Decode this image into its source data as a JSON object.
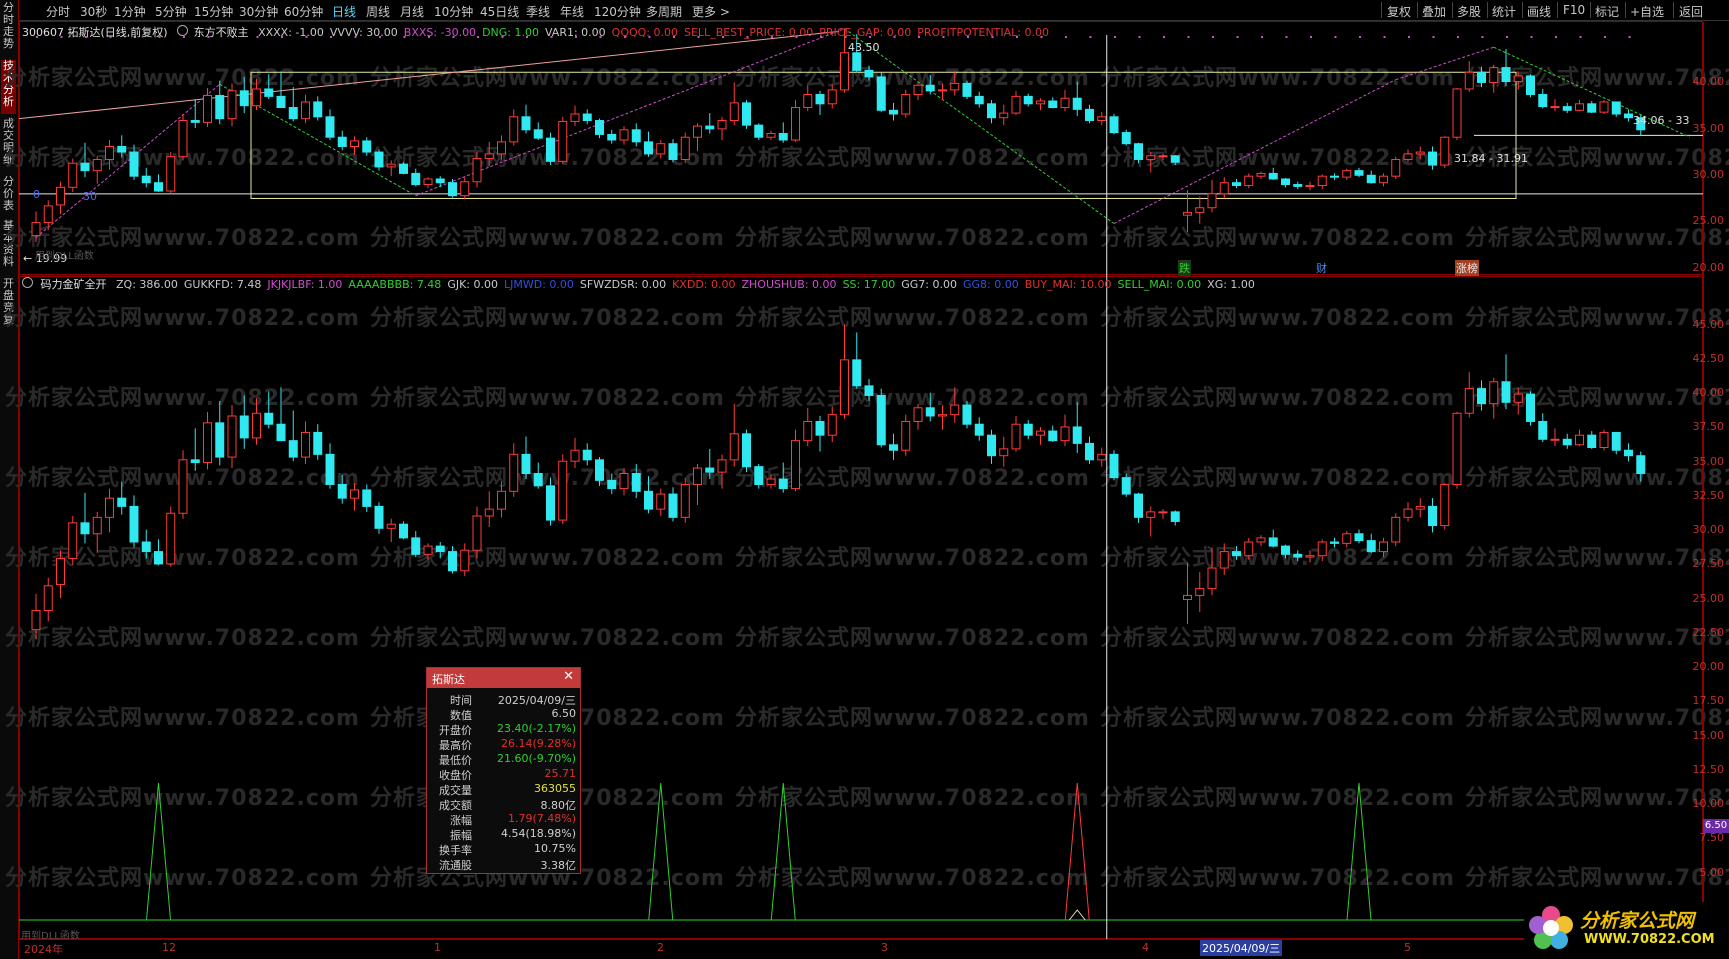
{
  "left_tabs": [
    "分时走势",
    "技术分析",
    "成交明细",
    "分价表",
    "基本资料",
    "开盘竞复"
  ],
  "toolbar": {
    "periods": [
      "分时",
      "30秒",
      "1分钟",
      "5分钟",
      "15分钟",
      "30分钟",
      "60分钟",
      "日线",
      "周线",
      "月线",
      "10分钟",
      "45日线",
      "季线",
      "年线",
      "120分钟",
      "多周期",
      "更多 >"
    ],
    "active_period": "日线",
    "right_items": [
      "复权",
      "叠加",
      "多股",
      "统计",
      "画线",
      "F10",
      "标记",
      "+自选",
      "返回"
    ]
  },
  "main_info": {
    "stock": "300607 拓斯达(日线,前复权)",
    "indicator_name": "东方不败主",
    "values": [
      {
        "text": "XXXX: -1.00",
        "color": "#c8c8c8"
      },
      {
        "text": "VVVV: 30.00",
        "color": "#c8c8c8"
      },
      {
        "text": "BXXS: -30.00",
        "color": "#d24cd2"
      },
      {
        "text": "DNG: 1.00",
        "color": "#30d030"
      },
      {
        "text": "VAR1: 0.00",
        "color": "#c8c8c8"
      },
      {
        "text": "QQQQ: 0.00",
        "color": "#e03030"
      },
      {
        "text": "SELL_BEST_PRICE: 0.00",
        "color": "#e03030"
      },
      {
        "text": "PRICE_GAP: 0.00",
        "color": "#e03030"
      },
      {
        "text": "PROFITPOTENTIAL: 0.00",
        "color": "#e03030"
      }
    ]
  },
  "main_annotations": {
    "high_label": "43.50",
    "low_label": "19.99",
    "range_label": "31.84 - 31.91",
    "right_label": "34.06 - 33",
    "markers": [
      "跌",
      "财",
      "涨榜"
    ],
    "small_zero": "0",
    "small_30": "30"
  },
  "main_axis": [
    "40.00",
    "35.00",
    "30.00",
    "25.00",
    "20.00"
  ],
  "sub_info": {
    "name": "码力金矿全开",
    "values": [
      {
        "text": "ZQ: 386.00",
        "color": "#c8c8c8"
      },
      {
        "text": "GUKKFD: 7.48",
        "color": "#c8c8c8"
      },
      {
        "text": "JKJKJLBF: 1.00",
        "color": "#d24cd2"
      },
      {
        "text": "AAAABBBB: 7.48",
        "color": "#30d030"
      },
      {
        "text": "GJK: 0.00",
        "color": "#c8c8c8"
      },
      {
        "text": "LJMWD: 0.00",
        "color": "#3050e0"
      },
      {
        "text": "SFWZDSR: 0.00",
        "color": "#c8c8c8"
      },
      {
        "text": "KXDD: 0.00",
        "color": "#e03030"
      },
      {
        "text": "ZHOUSHUB: 0.00",
        "color": "#d24cd2"
      },
      {
        "text": "SS: 17.00",
        "color": "#30d030"
      },
      {
        "text": "GG7: 0.00",
        "color": "#c8c8c8"
      },
      {
        "text": "GG8: 0.00",
        "color": "#3050e0"
      },
      {
        "text": "BUY_MAI: 10.00",
        "color": "#e03030"
      },
      {
        "text": "SELL_MAI: 0.00",
        "color": "#30d030"
      },
      {
        "text": "XG: 1.00",
        "color": "#c8c8c8"
      }
    ]
  },
  "sub_axis": [
    "45.00",
    "42.50",
    "40.00",
    "37.50",
    "35.00",
    "32.50",
    "30.00",
    "27.50",
    "25.00",
    "22.50",
    "20.00",
    "17.50",
    "15.00",
    "12.50",
    "10.00",
    "7.50",
    "5.00"
  ],
  "current_value_tag": "6.50",
  "bottom_note": "用到DLL函数",
  "top_note": "用到DLL函数",
  "date_axis": {
    "labels": [
      "2024年",
      "12",
      "1",
      "2",
      "3",
      "4",
      "5"
    ],
    "cursor_date": "2025/04/09/三"
  },
  "popup": {
    "title": "拓斯达",
    "rows": [
      {
        "label": "时间",
        "value": "2025/04/09/三",
        "color": "#d0d0d0"
      },
      {
        "label": "数值",
        "value": "6.50",
        "color": "#d0d0d0"
      },
      {
        "label": "开盘价",
        "value": "23.40(-2.17%)",
        "color": "#30d030"
      },
      {
        "label": "最高价",
        "value": "26.14(9.28%)",
        "color": "#e03030"
      },
      {
        "label": "最低价",
        "value": "21.60(-9.70%)",
        "color": "#30d030"
      },
      {
        "label": "收盘价",
        "value": "25.71",
        "color": "#e03030"
      },
      {
        "label": "成交量",
        "value": "363055",
        "color": "#e0e040"
      },
      {
        "label": "成交额",
        "value": "8.80亿",
        "color": "#d0d0d0"
      },
      {
        "label": "涨幅",
        "value": "1.79(7.48%)",
        "color": "#e03030"
      },
      {
        "label": "振幅",
        "value": "4.54(18.98%)",
        "color": "#d0d0d0"
      },
      {
        "label": "换手率",
        "value": "10.75%",
        "color": "#d0d0d0"
      },
      {
        "label": "流通股",
        "value": "3.38亿",
        "color": "#d0d0d0"
      }
    ]
  },
  "watermark": "分析家公式网www.70822.com",
  "logo": {
    "text": "分析家公式网",
    "url": "WWW.70822.COM"
  },
  "chart_data": {
    "type": "candlestick",
    "series_name": "拓斯达",
    "ohlc": [
      [
        21.2,
        23.8,
        20.5,
        22.6
      ],
      [
        22.6,
        25.0,
        21.8,
        24.4
      ],
      [
        24.5,
        27.0,
        23.5,
        26.4
      ],
      [
        26.4,
        29.5,
        25.9,
        29.0
      ],
      [
        29.0,
        31.2,
        27.5,
        28.2
      ],
      [
        28.2,
        29.8,
        26.8,
        29.4
      ],
      [
        29.4,
        31.5,
        28.3,
        30.8
      ],
      [
        30.8,
        32.0,
        29.6,
        30.2
      ],
      [
        30.2,
        31.0,
        27.2,
        27.6
      ],
      [
        27.6,
        28.5,
        26.4,
        26.9
      ],
      [
        26.9,
        27.8,
        25.9,
        26.0
      ],
      [
        26.0,
        30.2,
        25.8,
        29.7
      ],
      [
        29.7,
        34.3,
        29.3,
        33.6
      ],
      [
        33.6,
        35.9,
        32.8,
        33.4
      ],
      [
        33.4,
        37.1,
        32.9,
        36.3
      ],
      [
        36.3,
        37.9,
        33.2,
        33.8
      ],
      [
        33.8,
        37.6,
        33.0,
        36.8
      ],
      [
        36.8,
        38.3,
        34.4,
        35.2
      ],
      [
        35.2,
        38.1,
        34.7,
        37.0
      ],
      [
        37.0,
        38.6,
        35.9,
        36.2
      ],
      [
        36.2,
        38.9,
        35.6,
        35.0
      ],
      [
        35.0,
        37.2,
        33.5,
        33.8
      ],
      [
        33.8,
        36.4,
        33.3,
        35.6
      ],
      [
        35.6,
        36.2,
        33.6,
        34.0
      ],
      [
        34.0,
        34.8,
        31.5,
        31.8
      ],
      [
        31.8,
        32.5,
        30.4,
        30.8
      ],
      [
        30.8,
        31.9,
        29.9,
        31.4
      ],
      [
        31.4,
        31.8,
        29.8,
        30.2
      ],
      [
        30.2,
        30.5,
        28.2,
        28.6
      ],
      [
        28.6,
        29.3,
        27.6,
        28.9
      ],
      [
        28.9,
        29.1,
        27.8,
        27.9
      ],
      [
        27.9,
        28.4,
        26.5,
        26.7
      ],
      [
        26.7,
        27.5,
        26.3,
        27.3
      ],
      [
        27.3,
        27.6,
        26.4,
        26.9
      ],
      [
        26.9,
        27.3,
        25.3,
        25.5
      ],
      [
        25.5,
        27.5,
        25.1,
        27.0
      ],
      [
        27.0,
        30.2,
        26.4,
        29.5
      ],
      [
        29.5,
        31.3,
        28.7,
        30.0
      ],
      [
        30.0,
        32.0,
        29.4,
        31.3
      ],
      [
        31.3,
        34.8,
        30.9,
        34.0
      ],
      [
        34.0,
        35.3,
        32.2,
        32.6
      ],
      [
        32.6,
        33.4,
        31.5,
        31.7
      ],
      [
        31.7,
        32.3,
        28.8,
        29.2
      ],
      [
        29.2,
        34.0,
        28.9,
        33.5
      ],
      [
        33.5,
        35.2,
        33.0,
        34.3
      ],
      [
        34.3,
        34.8,
        33.2,
        33.6
      ],
      [
        33.6,
        33.8,
        31.7,
        32.1
      ],
      [
        32.1,
        32.6,
        31.1,
        31.5
      ],
      [
        31.5,
        33.0,
        31.0,
        32.6
      ],
      [
        32.6,
        33.3,
        30.8,
        31.3
      ],
      [
        31.3,
        32.4,
        29.7,
        30.0
      ],
      [
        30.0,
        31.5,
        29.5,
        31.1
      ],
      [
        31.1,
        31.6,
        29.1,
        29.4
      ],
      [
        29.4,
        32.3,
        29.0,
        31.8
      ],
      [
        31.8,
        33.3,
        30.3,
        33.0
      ],
      [
        33.0,
        34.4,
        32.2,
        32.7
      ],
      [
        32.7,
        34.0,
        31.5,
        33.6
      ],
      [
        33.6,
        37.7,
        33.1,
        35.5
      ],
      [
        35.5,
        35.8,
        32.7,
        33.1
      ],
      [
        33.1,
        33.3,
        31.5,
        31.8
      ],
      [
        31.8,
        32.5,
        31.5,
        32.2
      ],
      [
        32.2,
        33.4,
        31.2,
        31.5
      ],
      [
        31.5,
        35.8,
        31.3,
        35.0
      ],
      [
        35.0,
        37.4,
        34.6,
        36.4
      ],
      [
        36.4,
        36.8,
        34.2,
        35.4
      ],
      [
        35.4,
        37.5,
        34.9,
        36.9
      ],
      [
        36.9,
        43.5,
        36.6,
        40.9
      ],
      [
        40.9,
        42.9,
        38.8,
        39.0
      ],
      [
        39.0,
        39.5,
        37.9,
        38.3
      ],
      [
        38.3,
        38.8,
        34.5,
        34.7
      ],
      [
        34.7,
        35.5,
        33.6,
        34.3
      ],
      [
        34.3,
        36.9,
        33.9,
        36.4
      ],
      [
        36.4,
        37.7,
        35.8,
        37.4
      ],
      [
        37.4,
        38.5,
        36.4,
        36.8
      ],
      [
        36.8,
        37.6,
        35.8,
        36.9
      ],
      [
        36.9,
        38.9,
        36.3,
        37.6
      ],
      [
        37.6,
        37.9,
        35.9,
        36.2
      ],
      [
        36.2,
        36.7,
        35.0,
        35.4
      ],
      [
        35.4,
        35.8,
        33.3,
        33.9
      ],
      [
        33.9,
        35.3,
        33.1,
        34.4
      ],
      [
        34.4,
        36.8,
        34.2,
        36.2
      ],
      [
        36.2,
        36.5,
        35.1,
        35.4
      ],
      [
        35.4,
        36.0,
        34.7,
        35.7
      ],
      [
        35.7,
        36.1,
        34.9,
        35.0
      ],
      [
        35.0,
        36.9,
        34.6,
        36.0
      ],
      [
        36.0,
        37.8,
        34.1,
        34.8
      ],
      [
        34.8,
        35.3,
        33.3,
        33.6
      ],
      [
        33.6,
        34.5,
        33.1,
        34.0
      ],
      [
        34.0,
        34.3,
        32.1,
        32.3
      ],
      [
        32.3,
        32.6,
        30.9,
        31.1
      ],
      [
        31.1,
        31.2,
        29.0,
        29.4
      ],
      [
        29.4,
        30.2,
        28.0,
        29.8
      ],
      [
        29.8,
        30.0,
        29.3,
        29.8
      ],
      [
        29.8,
        29.9,
        28.8,
        29.1
      ],
      [
        23.4,
        26.1,
        21.6,
        23.7
      ],
      [
        23.7,
        25.4,
        22.5,
        24.2
      ],
      [
        24.2,
        27.2,
        23.7,
        25.7
      ],
      [
        25.7,
        27.5,
        25.2,
        26.9
      ],
      [
        26.9,
        27.3,
        26.3,
        26.6
      ],
      [
        26.6,
        27.9,
        26.3,
        27.6
      ],
      [
        27.6,
        28.1,
        27.3,
        27.9
      ],
      [
        27.9,
        28.5,
        27.2,
        27.3
      ],
      [
        27.3,
        27.4,
        26.4,
        26.7
      ],
      [
        26.7,
        27.0,
        26.2,
        26.5
      ],
      [
        26.5,
        27.0,
        26.1,
        26.6
      ],
      [
        26.6,
        27.8,
        26.2,
        27.6
      ],
      [
        27.6,
        27.9,
        27.2,
        27.5
      ],
      [
        27.5,
        28.4,
        27.2,
        28.2
      ],
      [
        28.2,
        28.5,
        27.5,
        27.7
      ],
      [
        27.7,
        28.2,
        26.8,
        26.9
      ],
      [
        26.9,
        27.9,
        26.5,
        27.6
      ],
      [
        27.6,
        29.7,
        27.3,
        29.4
      ],
      [
        29.4,
        30.5,
        29.1,
        30.0
      ],
      [
        30.0,
        30.8,
        29.4,
        30.2
      ],
      [
        30.2,
        30.8,
        28.3,
        28.8
      ],
      [
        28.8,
        31.9,
        28.5,
        31.8
      ],
      [
        31.8,
        37.1,
        31.5,
        37.0
      ],
      [
        37.0,
        40.0,
        36.7,
        38.8
      ],
      [
        38.8,
        39.4,
        37.2,
        37.7
      ],
      [
        37.7,
        39.6,
        36.6,
        39.3
      ],
      [
        39.3,
        41.3,
        37.3,
        37.8
      ],
      [
        37.8,
        38.9,
        36.9,
        38.4
      ],
      [
        38.4,
        38.6,
        36.1,
        36.4
      ],
      [
        36.4,
        37.0,
        34.9,
        35.1
      ],
      [
        35.1,
        35.9,
        34.6,
        35.1
      ],
      [
        35.1,
        35.5,
        34.4,
        34.7
      ],
      [
        34.7,
        35.8,
        34.6,
        35.4
      ],
      [
        35.4,
        35.7,
        34.4,
        34.5
      ],
      [
        34.5,
        35.8,
        34.3,
        35.6
      ],
      [
        35.6,
        35.6,
        34.0,
        34.3
      ],
      [
        34.3,
        34.8,
        33.5,
        33.9
      ],
      [
        33.9,
        34.2,
        32.0,
        32.6
      ]
    ],
    "sub_signals": [
      false,
      false,
      false,
      false,
      false,
      false,
      false,
      false,
      false,
      false,
      false,
      false,
      false,
      false,
      false,
      false,
      false,
      false,
      false,
      false,
      false,
      false,
      false,
      false,
      false,
      false,
      false,
      false,
      false,
      false,
      false,
      false,
      false,
      false,
      false,
      false,
      false,
      false,
      false,
      false,
      false,
      false,
      false,
      false,
      false,
      false,
      false,
      false,
      false,
      false,
      false,
      false,
      false,
      false,
      false,
      false,
      false,
      false,
      false,
      false,
      false,
      false,
      false,
      false,
      false,
      false,
      false,
      false,
      false,
      false,
      false,
      false,
      false,
      false,
      false,
      false,
      false,
      false,
      false,
      false,
      false,
      false,
      false,
      false,
      false,
      false,
      false,
      false,
      false,
      false,
      false,
      false,
      false,
      false,
      false,
      false,
      false,
      false,
      false,
      false,
      false,
      false,
      false,
      false,
      false,
      false,
      false,
      false,
      false,
      false,
      false,
      false,
      false,
      false,
      false,
      false,
      false,
      false,
      false,
      false,
      false,
      false,
      false,
      false,
      false,
      false,
      false,
      false,
      false,
      false,
      false,
      false,
      false,
      false,
      false,
      false
    ],
    "sub_spikes_green_index": [
      10,
      51,
      61,
      108
    ],
    "sub_spikes_red_index": [
      85
    ],
    "main_ylim": [
      19,
      44
    ],
    "sub_ylim": [
      0,
      46
    ],
    "xlabel": "",
    "ylabel": ""
  }
}
